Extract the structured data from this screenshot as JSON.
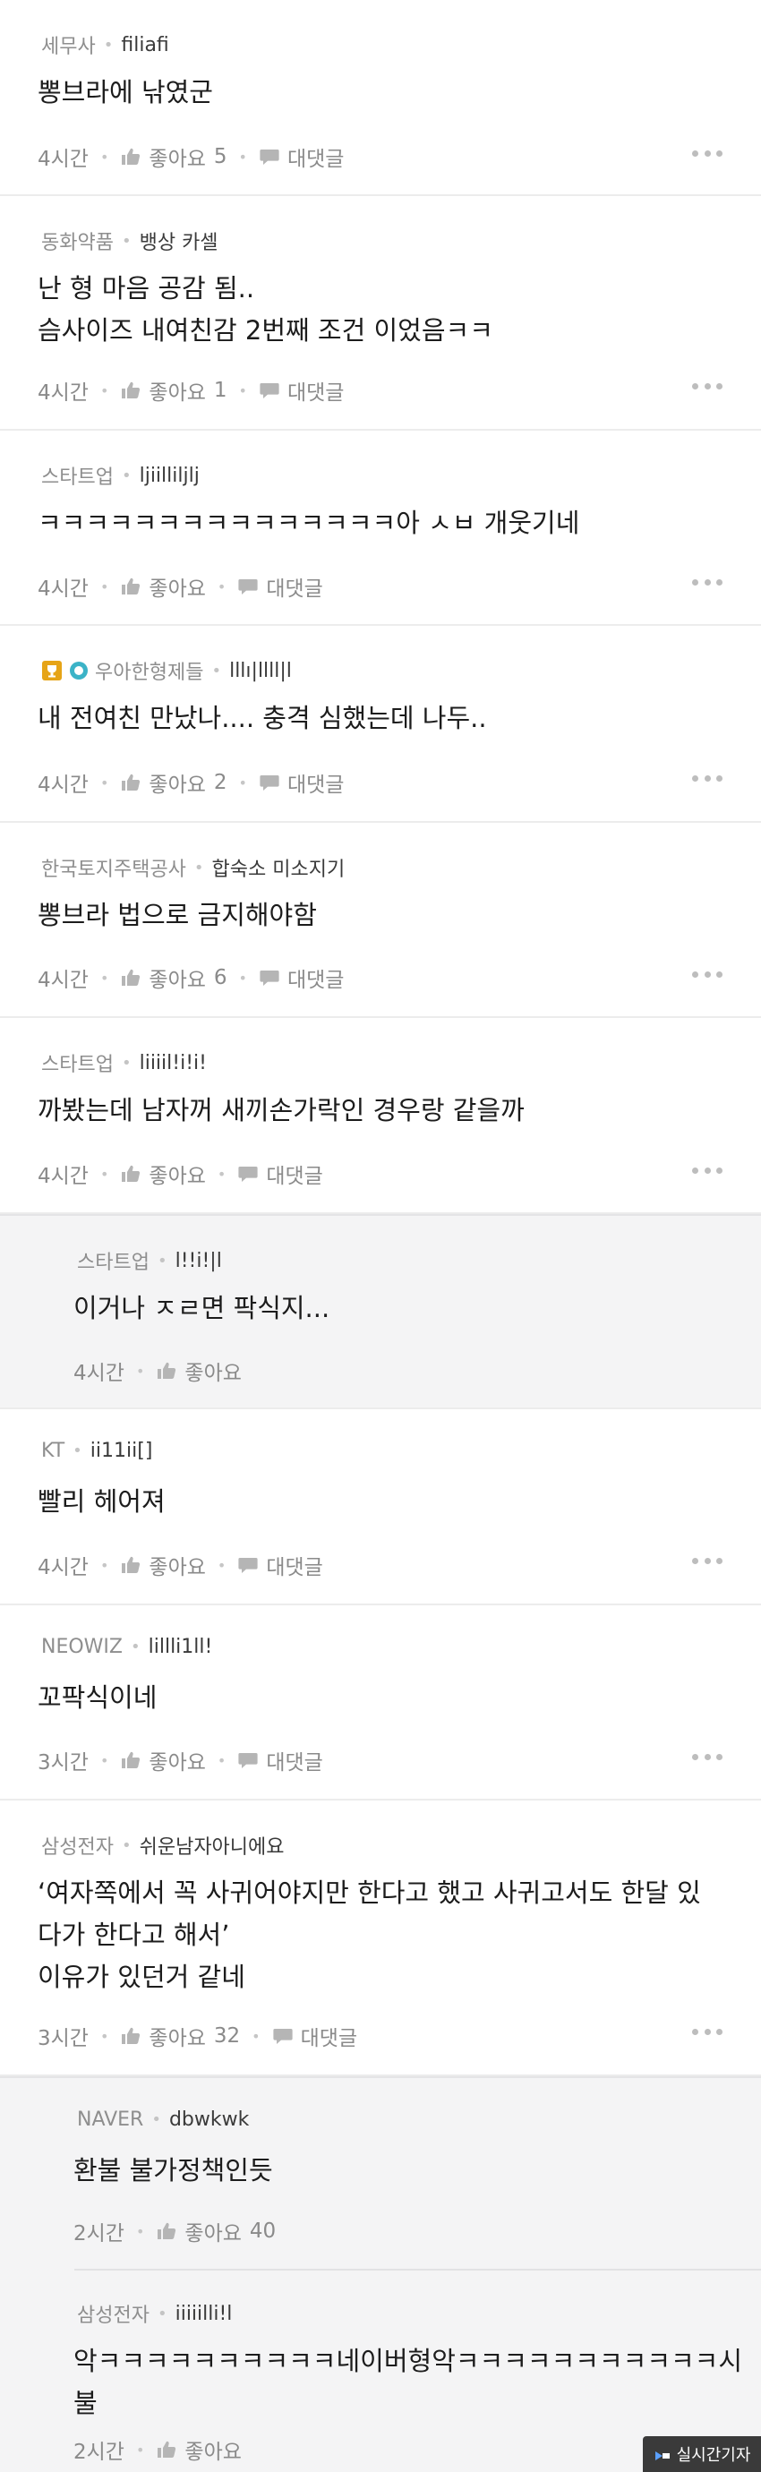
{
  "labels": {
    "like": "좋아요",
    "reply": "대댓글"
  },
  "comments": [
    {
      "company": "세무사",
      "nick": "filiafi",
      "lines": [
        "뽕브라에 낚였군"
      ],
      "time": "4시간",
      "likes": "5",
      "reply": true
    },
    {
      "company": "동화약품",
      "nick": "뱅상 카셀",
      "lines": [
        "난 형 마음 공감 됨..",
        "슴사이즈 내여친감 2번째 조건 이었음ㅋㅋ"
      ],
      "time": "4시간",
      "likes": "1",
      "reply": true
    },
    {
      "company": "스타트업",
      "nick": "ljiilliljlj",
      "lines": [
        "ㅋㅋㅋㅋㅋㅋㅋㅋㅋㅋㅋㅋㅋㅋㅋ아 ㅅㅂ 개웃기네"
      ],
      "time": "4시간",
      "likes": "",
      "reply": true
    },
    {
      "company": "우아한형제들",
      "nick": "lllı|llll|l",
      "lines": [
        "내 전여친 만났나.... 충격 심했는데 나두.."
      ],
      "time": "4시간",
      "likes": "2",
      "reply": true
    },
    {
      "company": "한국토지주택공사",
      "nick": "합숙소 미소지기",
      "lines": [
        "뽕브라 법으로 금지해야함"
      ],
      "time": "4시간",
      "likes": "6",
      "reply": true
    },
    {
      "company": "스타트업",
      "nick": "liiiil!i!i!",
      "lines": [
        "까봤는데 남자꺼 새끼손가락인 경우랑 같을까"
      ],
      "time": "4시간",
      "likes": "",
      "reply": true
    },
    {
      "company": "스타트업",
      "nick": "l!!i!|l",
      "lines": [
        "이거나 ㅈㄹ면 팍식지..."
      ],
      "time": "4시간",
      "likes": "",
      "reply": false
    },
    {
      "company": "KT",
      "nick": "ii11ii[]",
      "lines": [
        "빨리 헤어져"
      ],
      "time": "4시간",
      "likes": "",
      "reply": true
    },
    {
      "company": "NEOWIZ",
      "nick": "lillli1ll!",
      "lines": [
        "꼬팍식이네"
      ],
      "time": "3시간",
      "likes": "",
      "reply": true
    },
    {
      "company": "삼성전자",
      "nick": "쉬운남자아니에요",
      "lines": [
        "‘여자쪽에서 꼭 사귀어야지만 한다고 했고 사귀고서도 한달 있",
        "다가 한다고 해서’",
        "이유가 있던거 같네"
      ],
      "time": "3시간",
      "likes": "32",
      "reply": true
    },
    {
      "company": "NAVER",
      "nick": "dbwkwk",
      "lines": [
        "환불 불가정책인듯"
      ],
      "time": "2시간",
      "likes": "40",
      "reply": false
    },
    {
      "company": "삼성전자",
      "nick": "iiiiilli!l",
      "lines": [
        "악ㅋㅋㅋㅋㅋㅋㅋㅋㅋㅋ네이버형악ㅋㅋㅋㅋㅋㅋㅋㅋㅋㅋㅋ시",
        "불"
      ],
      "time": "2시간",
      "likes": "",
      "reply": false
    }
  ],
  "watermark": "실시간기자"
}
